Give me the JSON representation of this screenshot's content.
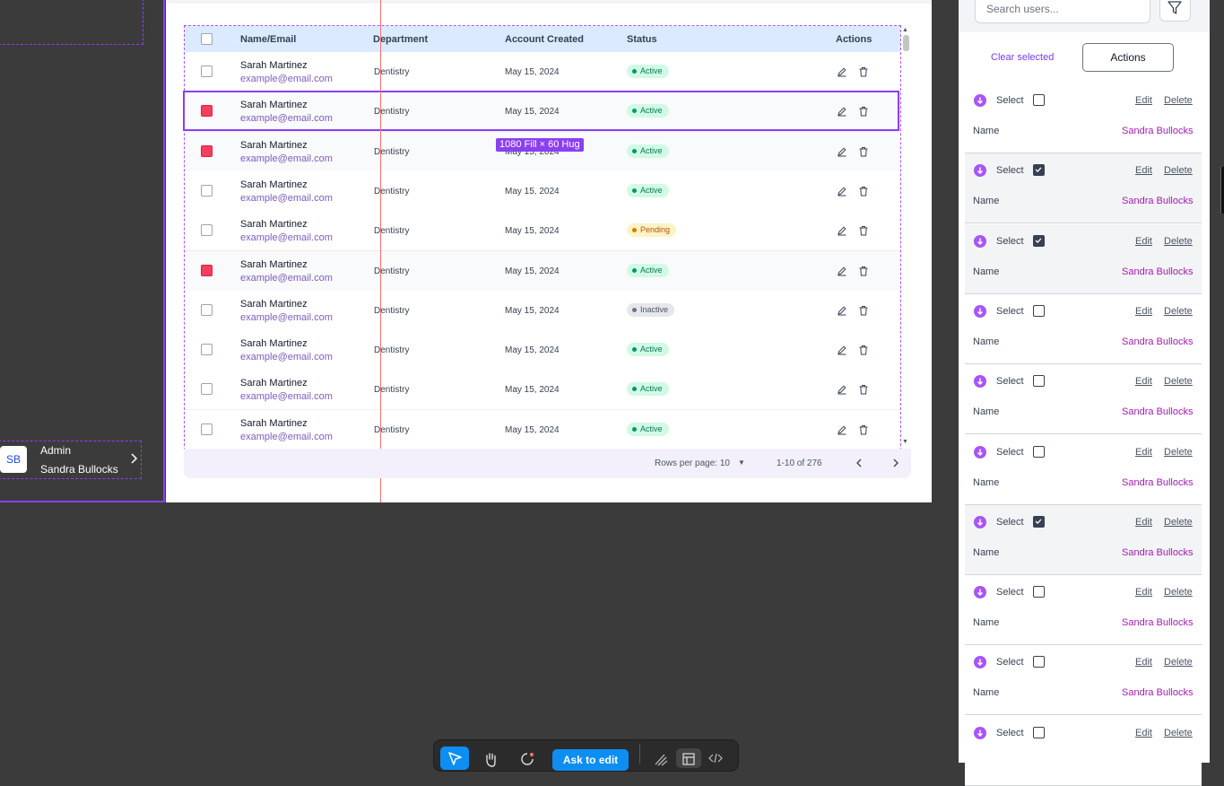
{
  "sidebar": {
    "avatar_initials": "SB",
    "user_role": "Admin",
    "user_name": "Sandra Bullocks"
  },
  "table": {
    "headers": {
      "name": "Name/Email",
      "department": "Department",
      "created": "Account Created",
      "status": "Status",
      "actions": "Actions"
    },
    "rows": [
      {
        "name": "Sarah Martinez",
        "email": "example@email.com",
        "department": "Dentistry",
        "created": "May 15, 2024",
        "status": "Active",
        "checked": false
      },
      {
        "name": "Sarah Martinez",
        "email": "example@email.com",
        "department": "Dentistry",
        "created": "May 15, 2024",
        "status": "Active",
        "checked": true
      },
      {
        "name": "Sarah Martinez",
        "email": "example@email.com",
        "department": "Dentistry",
        "created": "May 15, 2024",
        "status": "Active",
        "checked": true
      },
      {
        "name": "Sarah Martinez",
        "email": "example@email.com",
        "department": "Dentistry",
        "created": "May 15, 2024",
        "status": "Active",
        "checked": false
      },
      {
        "name": "Sarah Martinez",
        "email": "example@email.com",
        "department": "Dentistry",
        "created": "May 15, 2024",
        "status": "Pending",
        "checked": false
      },
      {
        "name": "Sarah Martinez",
        "email": "example@email.com",
        "department": "Dentistry",
        "created": "May 15, 2024",
        "status": "Active",
        "checked": true
      },
      {
        "name": "Sarah Martinez",
        "email": "example@email.com",
        "department": "Dentistry",
        "created": "May 15, 2024",
        "status": "Inactive",
        "checked": false
      },
      {
        "name": "Sarah Martinez",
        "email": "example@email.com",
        "department": "Dentistry",
        "created": "May 15, 2024",
        "status": "Active",
        "checked": false
      },
      {
        "name": "Sarah Martinez",
        "email": "example@email.com",
        "department": "Dentistry",
        "created": "May 15, 2024",
        "status": "Active",
        "checked": false
      },
      {
        "name": "Sarah Martinez",
        "email": "example@email.com",
        "department": "Dentistry",
        "created": "May 15, 2024",
        "status": "Active",
        "checked": false
      }
    ],
    "size_tag": "1080 Fill × 60 Hug"
  },
  "pagination": {
    "rows_per_page": "Rows per page: 10",
    "range": "1-10 of 276"
  },
  "right_panel": {
    "search_placeholder": "Search users...",
    "clear_selected": "Clear selected",
    "actions_label": "Actions",
    "cards": [
      {
        "select_label": "Select",
        "checked": false,
        "edit": "Edit",
        "delete": "Delete",
        "field_label": "Name",
        "field_value": "Sandra Bullocks"
      },
      {
        "select_label": "Select",
        "checked": true,
        "edit": "Edit",
        "delete": "Delete",
        "field_label": "Name",
        "field_value": "Sandra Bullocks"
      },
      {
        "select_label": "Select",
        "checked": true,
        "edit": "Edit",
        "delete": "Delete",
        "field_label": "Name",
        "field_value": "Sandra Bullocks"
      },
      {
        "select_label": "Select",
        "checked": false,
        "edit": "Edit",
        "delete": "Delete",
        "field_label": "Name",
        "field_value": "Sandra Bullocks"
      },
      {
        "select_label": "Select",
        "checked": false,
        "edit": "Edit",
        "delete": "Delete",
        "field_label": "Name",
        "field_value": "Sandra Bullocks"
      },
      {
        "select_label": "Select",
        "checked": false,
        "edit": "Edit",
        "delete": "Delete",
        "field_label": "Name",
        "field_value": "Sandra Bullocks"
      },
      {
        "select_label": "Select",
        "checked": true,
        "edit": "Edit",
        "delete": "Delete",
        "field_label": "Name",
        "field_value": "Sandra Bullocks"
      },
      {
        "select_label": "Select",
        "checked": false,
        "edit": "Edit",
        "delete": "Delete",
        "field_label": "Name",
        "field_value": "Sandra Bullocks"
      },
      {
        "select_label": "Select",
        "checked": false,
        "edit": "Edit",
        "delete": "Delete",
        "field_label": "Name",
        "field_value": "Sandra Bullocks"
      },
      {
        "select_label": "Select",
        "checked": false,
        "edit": "Edit",
        "delete": "Delete",
        "field_label": "",
        "field_value": ""
      }
    ]
  },
  "toolbar": {
    "ask_to_edit": "Ask to edit",
    "icons": [
      "cursor-icon",
      "hand-icon",
      "comment-icon",
      "draw-icon",
      "layout-icon",
      "code-icon"
    ]
  },
  "colors": {
    "accent": "#8b3ff2",
    "primary_blue": "#0d8ef2",
    "checked_red": "#f43f5e",
    "header_blue": "#dbeafe",
    "canvas": "#3b3b3b"
  }
}
